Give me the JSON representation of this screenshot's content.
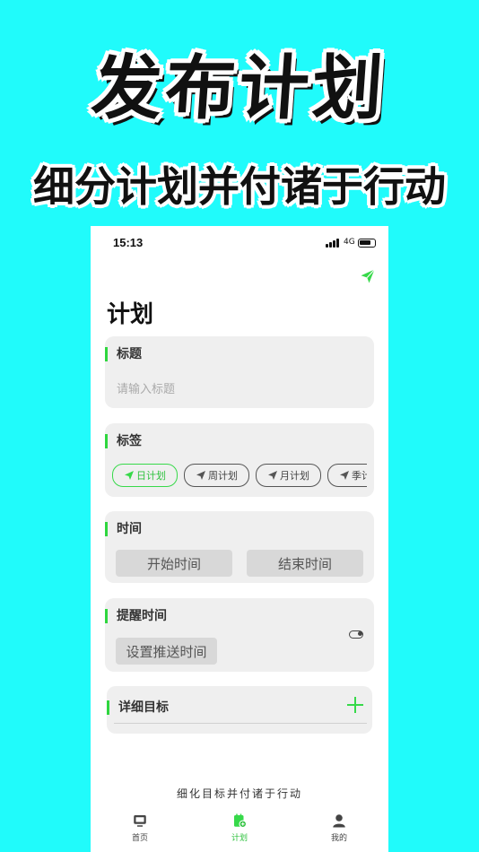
{
  "promo": {
    "title": "发布计划",
    "subtitle": "细分计划并付诸于行动"
  },
  "status_bar": {
    "time": "15:13",
    "network": "4G"
  },
  "page": {
    "title": "计划"
  },
  "form": {
    "title_section": {
      "label": "标题",
      "placeholder": "请输入标题"
    },
    "tags_section": {
      "label": "标签",
      "chips": [
        "日计划",
        "周计划",
        "月计划",
        "季计"
      ],
      "selected": "日计划"
    },
    "time_section": {
      "label": "时间",
      "start_button": "开始时间",
      "end_button": "结束时间"
    },
    "reminder_section": {
      "label": "提醒时间",
      "push_button": "设置推送时间",
      "toggle_on": false
    },
    "detail_section": {
      "label": "详细目标"
    }
  },
  "footer": {
    "slogan": "细化目标并付诸于行动"
  },
  "tabbar": {
    "items": [
      {
        "label": "首页",
        "icon": "monitor-icon"
      },
      {
        "label": "计划",
        "icon": "calendar-add-icon"
      },
      {
        "label": "我的",
        "icon": "user-icon"
      }
    ],
    "active": "计划"
  },
  "colors": {
    "background": "#20fbfb",
    "accent": "#37d94a"
  }
}
